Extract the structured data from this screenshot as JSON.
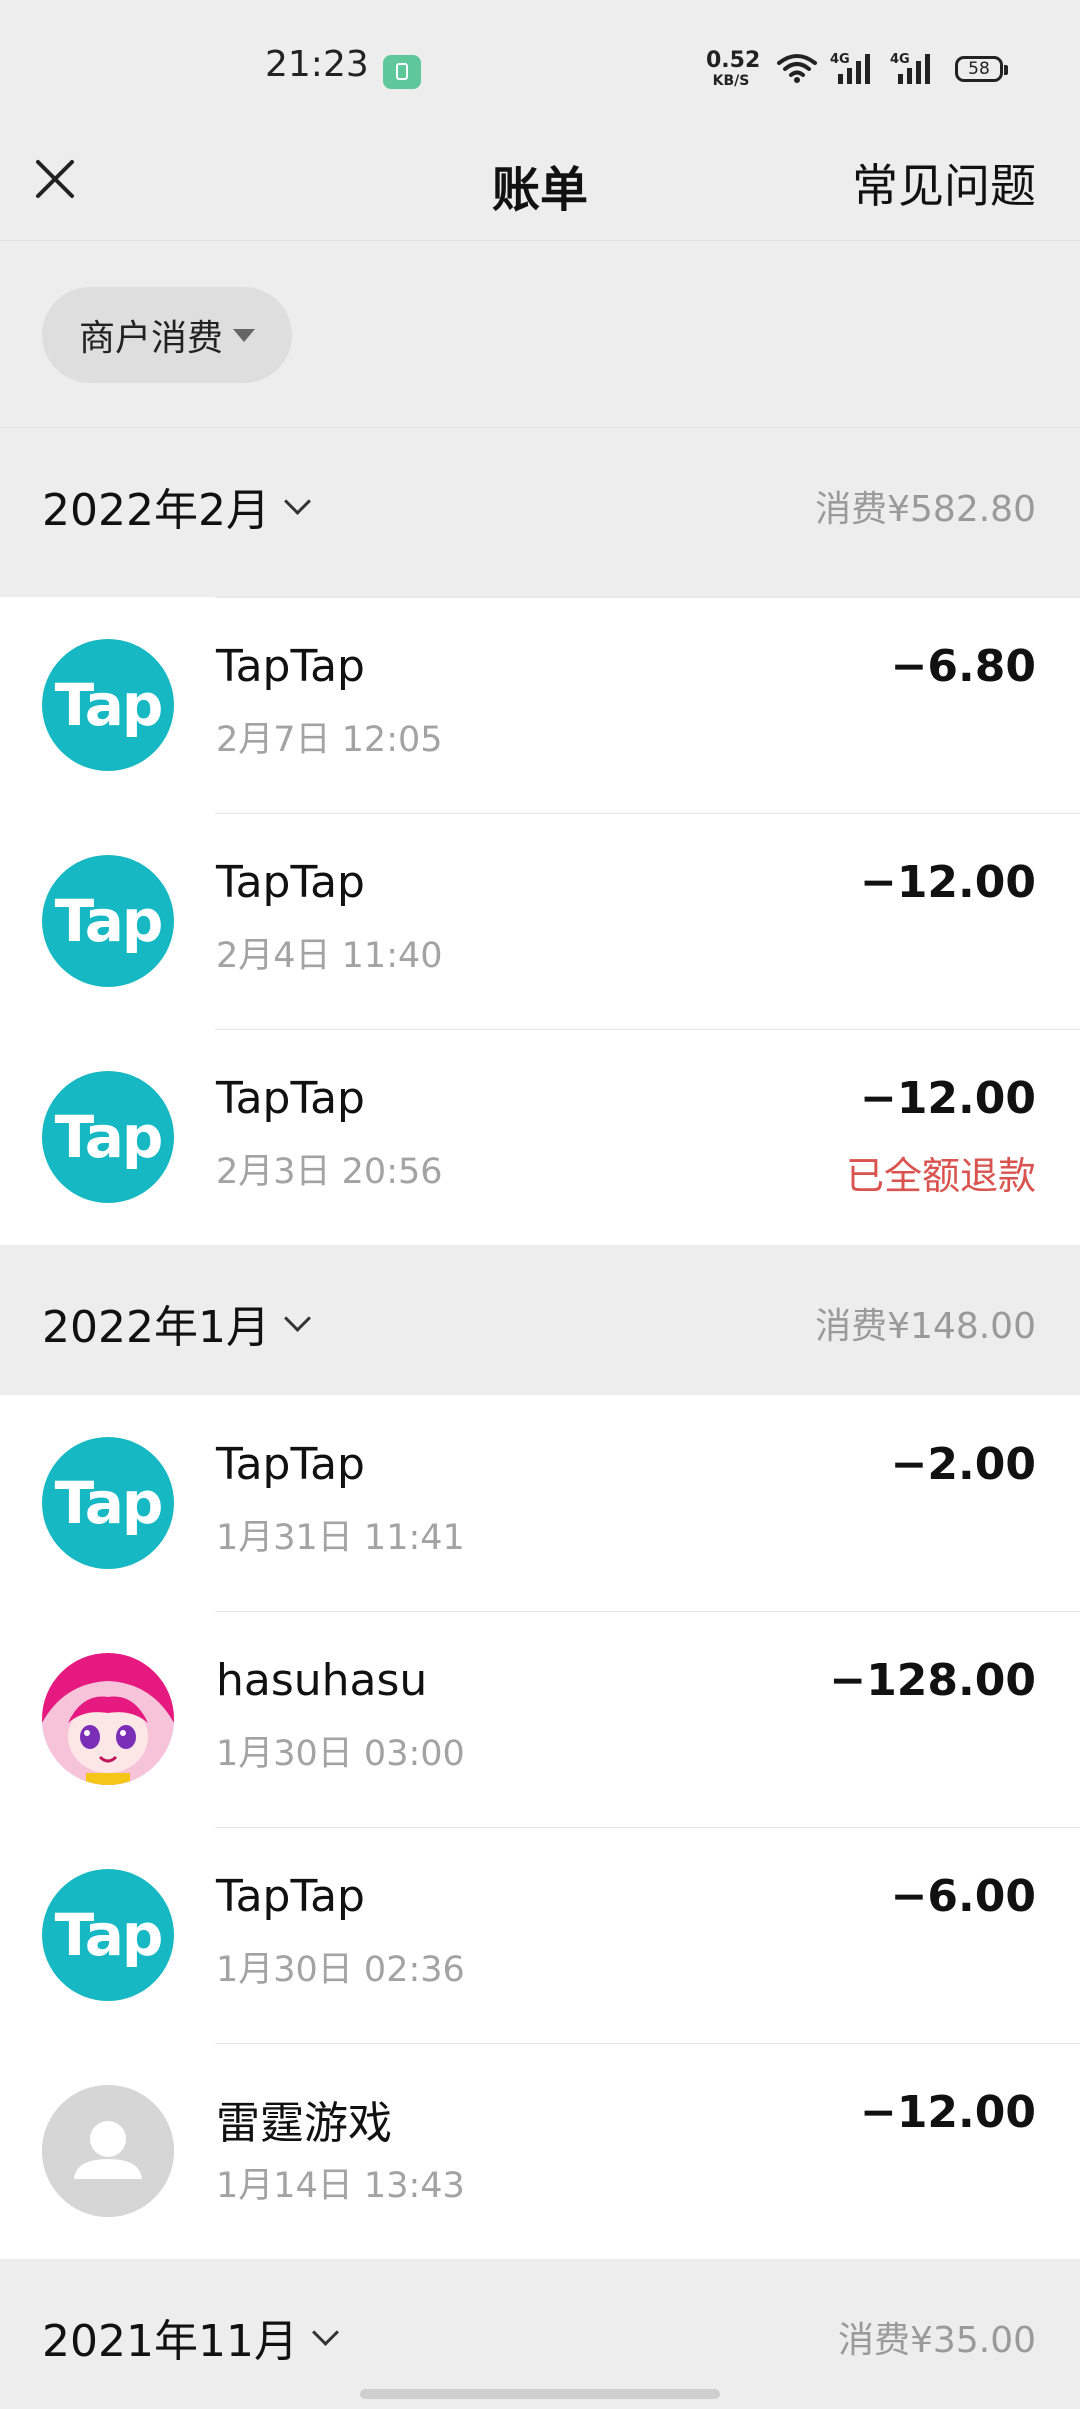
{
  "status_bar": {
    "time": "21:23",
    "net_speed_value": "0.52",
    "net_speed_unit": "KB/S",
    "network_1": "4G",
    "network_2": "4G",
    "battery": "58"
  },
  "header": {
    "title": "账单",
    "faq": "常见问题"
  },
  "filter": {
    "label": "商户消费"
  },
  "months": [
    {
      "label": "2022年2月",
      "total": "消费¥582.80",
      "transactions": [
        {
          "merchant": "TapTap",
          "time": "2月7日 12:05",
          "amount": "−6.80",
          "status": "",
          "icon": "taptap-logo"
        },
        {
          "merchant": "TapTap",
          "time": "2月4日 11:40",
          "amount": "−12.00",
          "status": "",
          "icon": "taptap-logo"
        },
        {
          "merchant": "TapTap",
          "time": "2月3日 20:56",
          "amount": "−12.00",
          "status": "已全额退款",
          "icon": "taptap-logo"
        }
      ]
    },
    {
      "label": "2022年1月",
      "total": "消费¥148.00",
      "transactions": [
        {
          "merchant": "TapTap",
          "time": "1月31日 11:41",
          "amount": "−2.00",
          "status": "",
          "icon": "taptap-logo"
        },
        {
          "merchant": "hasuhasu",
          "time": "1月30日 03:00",
          "amount": "−128.00",
          "status": "",
          "icon": "anime-avatar"
        },
        {
          "merchant": "TapTap",
          "time": "1月30日 02:36",
          "amount": "−6.00",
          "status": "",
          "icon": "taptap-logo"
        },
        {
          "merchant": "雷霆游戏",
          "time": "1月14日 13:43",
          "amount": "−12.00",
          "status": "",
          "icon": "default-avatar"
        }
      ]
    },
    {
      "label": "2021年11月",
      "total": "消费¥35.00",
      "transactions": []
    }
  ],
  "logo_text": "Tap",
  "colors": {
    "background": "#ededed",
    "taptap_brand": "#15b8c3",
    "refund_red": "#d9534f",
    "secondary_text": "#a3a3a3"
  }
}
